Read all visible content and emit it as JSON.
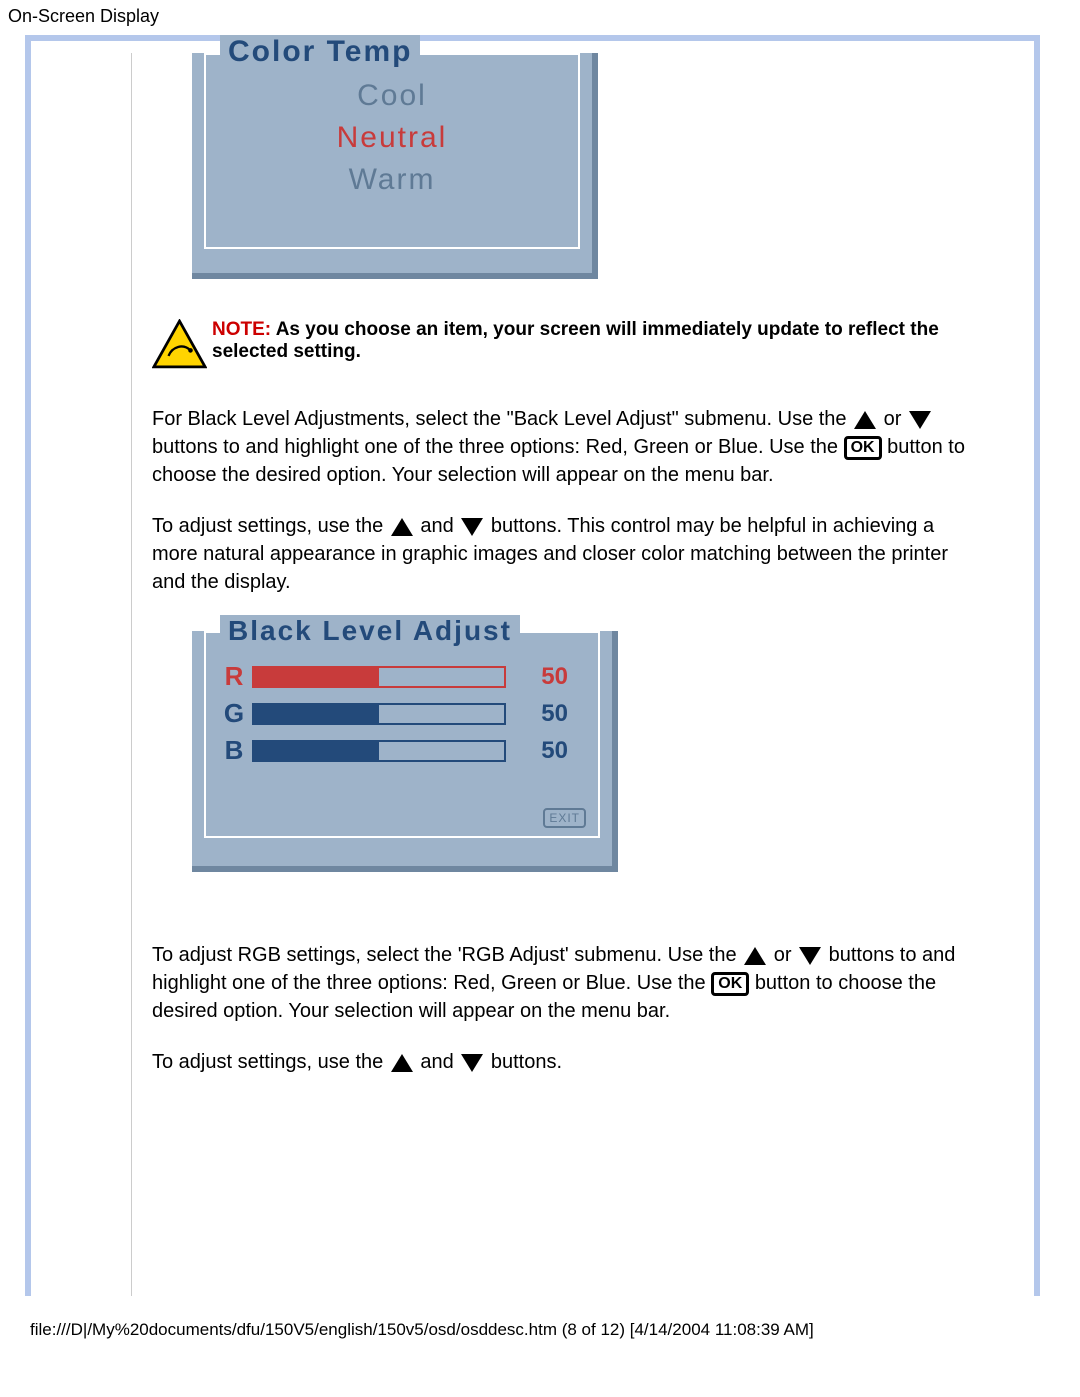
{
  "page_header": "On-Screen Display",
  "osd1": {
    "title": "Color Temp",
    "options": [
      "Cool",
      "Neutral",
      "Warm"
    ],
    "selected_index": 1
  },
  "note": {
    "prefix": "NOTE:",
    "text": "As you choose an item, your screen will immediately update to reflect the selected setting."
  },
  "para1": {
    "a": "For Black Level Adjustments, select the \"Back Level Adjust\" submenu. Use the ",
    "b": " or ",
    "c": " buttons to and highlight one of the three options: Red, Green or Blue. Use the ",
    "d": " button to choose the desired option. Your selection will appear on the menu bar."
  },
  "para2": {
    "a": "To adjust settings, use the ",
    "b": " and ",
    "c": " buttons. This control may be helpful in achieving a more natural appearance in graphic images and closer color matching between the printer and the display."
  },
  "osd2": {
    "title": "Black Level Adjust",
    "rows": [
      {
        "label": "R",
        "value": 50,
        "pct": 50
      },
      {
        "label": "G",
        "value": 50,
        "pct": 50
      },
      {
        "label": "B",
        "value": 50,
        "pct": 50
      }
    ],
    "exit_label": "EXIT"
  },
  "para3": {
    "a": "To adjust RGB settings, select the 'RGB Adjust' submenu. Use the ",
    "b": " or ",
    "c": " buttons to and highlight one of the three options: Red, Green or Blue. Use the ",
    "d": " button to choose the desired option. Your selection will appear on the menu bar."
  },
  "para4": {
    "a": "To adjust settings, use the ",
    "b": " and ",
    "c": " buttons."
  },
  "ok_label": "OK",
  "footer": "file:///D|/My%20documents/dfu/150V5/english/150v5/osd/osddesc.htm (8 of 12) [4/14/2004 11:08:39 AM]"
}
